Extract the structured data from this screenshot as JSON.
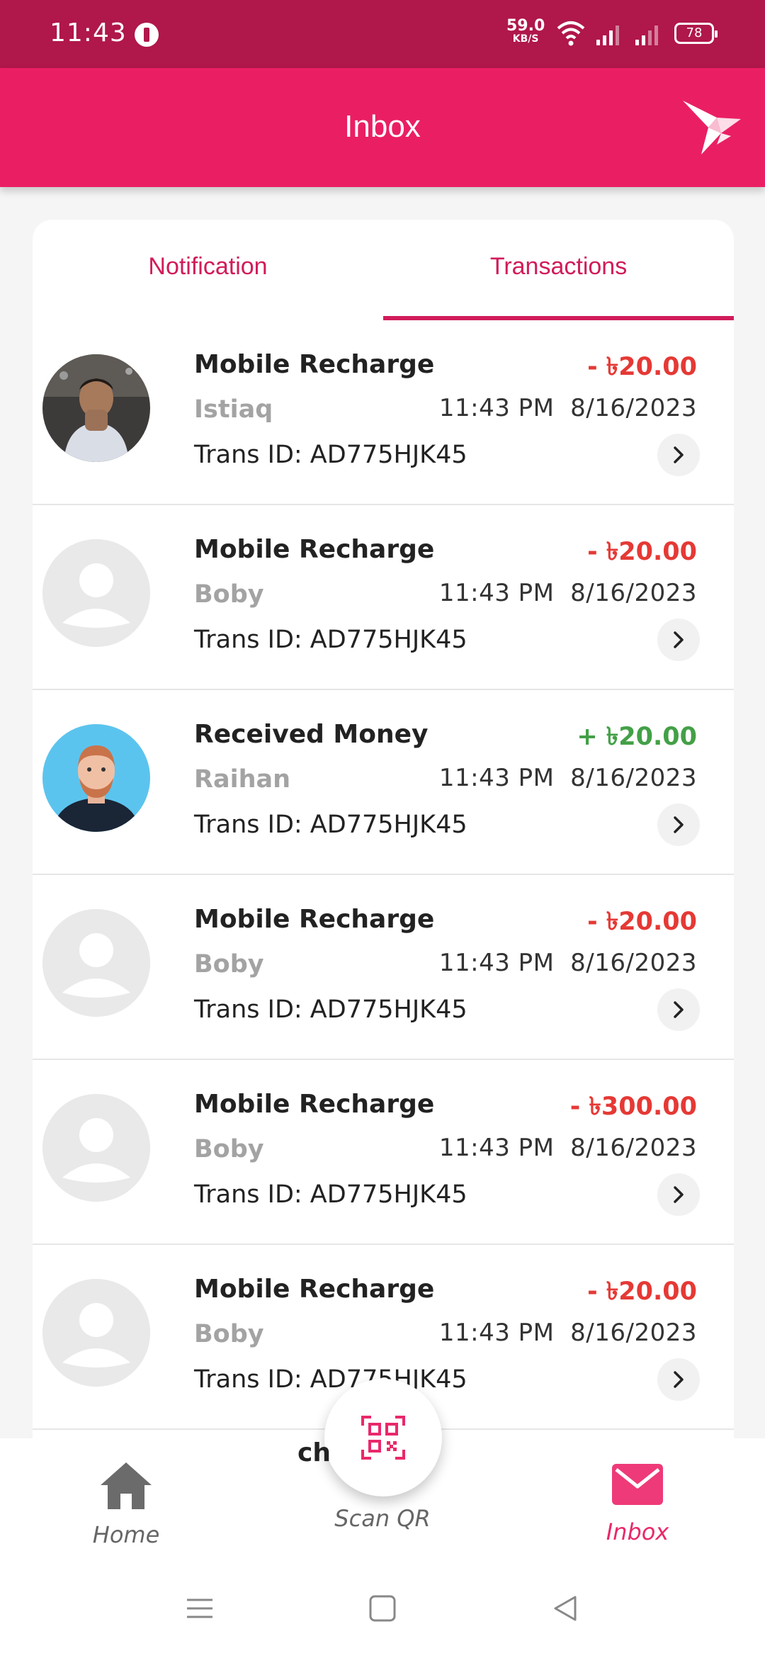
{
  "status_bar": {
    "time": "11:43",
    "net_speed_value": "59.0",
    "net_speed_unit": "KB/S",
    "battery": "78"
  },
  "app_bar": {
    "title": "Inbox",
    "logo_icon": "paper-bird-icon"
  },
  "tabs": [
    {
      "label": "Notification",
      "active": false
    },
    {
      "label": "Transactions",
      "active": true
    }
  ],
  "transactions": [
    {
      "title": "Mobile Recharge",
      "name": "Istiaq",
      "trans_id": "Trans ID: AD775HJK45",
      "amount": "- ৳20.00",
      "type": "debit",
      "time": "11:43 PM",
      "date": "8/16/2023",
      "avatar": "photo-man"
    },
    {
      "title": "Mobile Recharge",
      "name": "Boby",
      "trans_id": "Trans ID: AD775HJK45",
      "amount": "- ৳20.00",
      "type": "debit",
      "time": "11:43 PM",
      "date": "8/16/2023",
      "avatar": "placeholder"
    },
    {
      "title": "Received Money",
      "name": "Raihan",
      "trans_id": "Trans ID: AD775HJK45",
      "amount": "+ ৳20.00",
      "type": "credit",
      "time": "11:43 PM",
      "date": "8/16/2023",
      "avatar": "illustration-man"
    },
    {
      "title": "Mobile Recharge",
      "name": "Boby",
      "trans_id": "Trans ID: AD775HJK45",
      "amount": "- ৳20.00",
      "type": "debit",
      "time": "11:43 PM",
      "date": "8/16/2023",
      "avatar": "placeholder"
    },
    {
      "title": "Mobile Recharge",
      "name": "Boby",
      "trans_id": "Trans ID: AD775HJK45",
      "amount": "- ৳300.00",
      "type": "debit",
      "time": "11:43 PM",
      "date": "8/16/2023",
      "avatar": "placeholder"
    },
    {
      "title": "Mobile Recharge",
      "name": "Boby",
      "trans_id": "Trans ID: AD775HJK45",
      "amount": "- ৳20.00",
      "type": "debit",
      "time": "11:43 PM",
      "date": "8/16/2023",
      "avatar": "placeholder"
    }
  ],
  "partial_text": "ch",
  "bottom_nav": {
    "home_label": "Home",
    "scan_label": "Scan QR",
    "inbox_label": "Inbox",
    "active": "inbox"
  },
  "colors": {
    "status_bar": "#b0174a",
    "app_bar": "#ea1f63",
    "accent": "#d11b5b",
    "debit": "#e53935",
    "credit": "#43a047",
    "inactive_nav": "#666666"
  }
}
